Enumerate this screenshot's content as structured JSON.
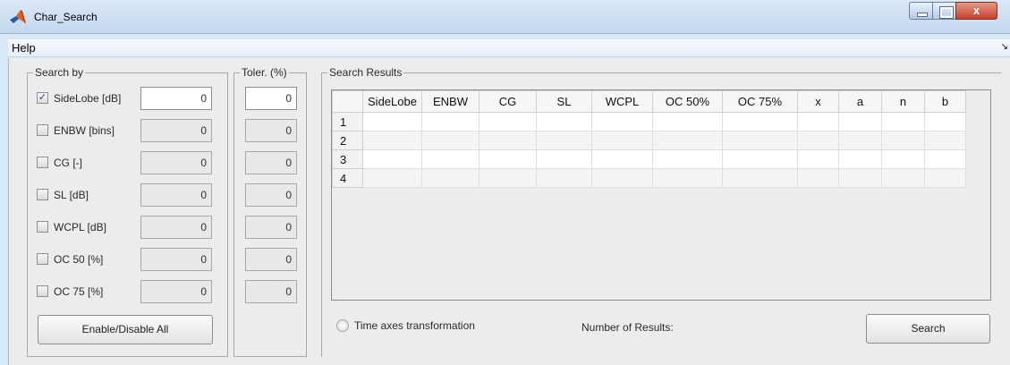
{
  "window": {
    "title": "Char_Search",
    "close_glyph": "x"
  },
  "menu": {
    "help": "Help",
    "arrow": "↘"
  },
  "search_by": {
    "title": "Search by",
    "rows": [
      {
        "label": "SideLobe [dB]",
        "checked": true,
        "value": "0"
      },
      {
        "label": "ENBW [bins]",
        "checked": false,
        "value": "0"
      },
      {
        "label": "CG [-]",
        "checked": false,
        "value": "0"
      },
      {
        "label": "SL [dB]",
        "checked": false,
        "value": "0"
      },
      {
        "label": "WCPL [dB]",
        "checked": false,
        "value": "0"
      },
      {
        "label": "OC 50 [%]",
        "checked": false,
        "value": "0"
      },
      {
        "label": "OC 75 [%]",
        "checked": false,
        "value": "0"
      }
    ],
    "enable_all_label": "Enable/Disable All"
  },
  "toler": {
    "title": "Toler. (%)",
    "values": [
      "0",
      "0",
      "0",
      "0",
      "0",
      "0",
      "0"
    ]
  },
  "results": {
    "title": "Search Results",
    "columns": [
      "SideLobe",
      "ENBW",
      "CG",
      "SL",
      "WCPL",
      "OC 50%",
      "OC 75%",
      "x",
      "a",
      "n",
      "b"
    ],
    "rows": [
      "1",
      "2",
      "3",
      "4"
    ],
    "time_axes_label": "Time axes transformation",
    "number_of_results_label": "Number of Results:",
    "search_label": "Search"
  },
  "icons": {
    "app": "matlab-icon",
    "check": "✓"
  }
}
